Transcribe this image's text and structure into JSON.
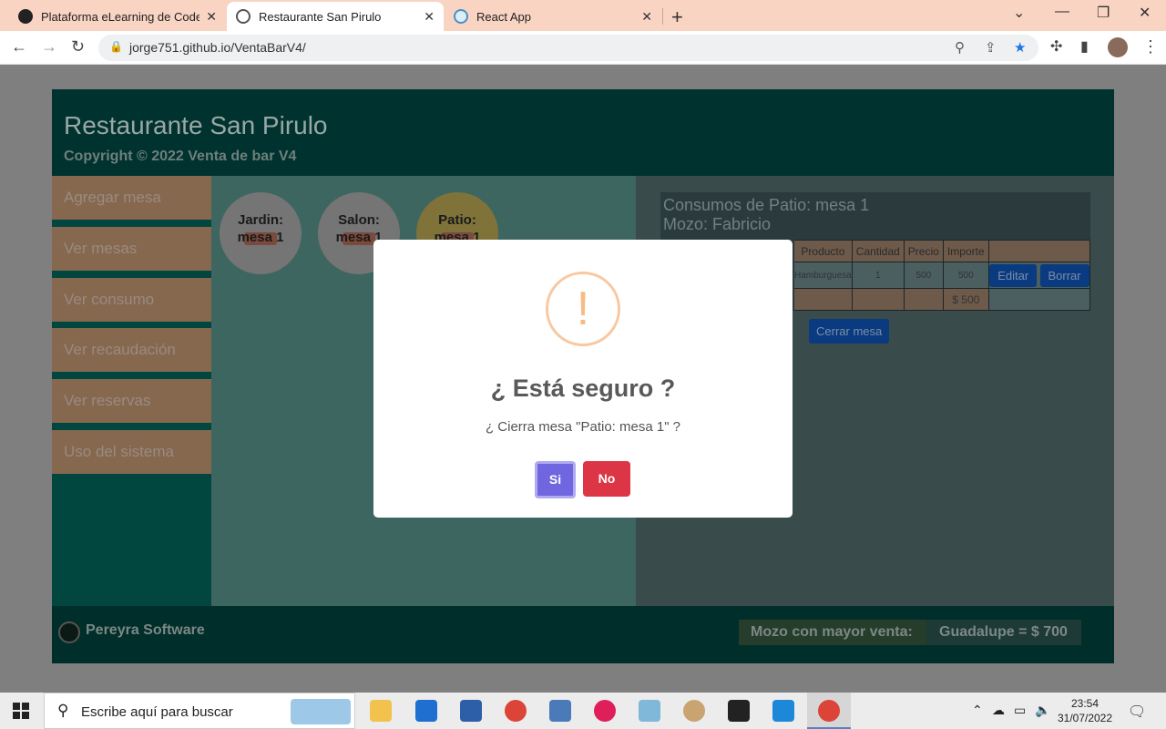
{
  "browser": {
    "tabs": [
      {
        "title": "Plataforma eLearning de Coderhouse",
        "active": false
      },
      {
        "title": "Restaurante San Pirulo",
        "active": true
      },
      {
        "title": "React App",
        "active": false
      }
    ],
    "url": "jorge751.github.io/VentaBarV4/"
  },
  "header": {
    "title": "Restaurante San Pirulo",
    "subtitle": "Copyright © 2022 Venta de bar V4"
  },
  "sidebar": {
    "items": [
      "Agregar mesa",
      "Ver mesas",
      "Ver consumo",
      "Ver recaudación",
      "Ver reservas",
      "Uso del sistema"
    ]
  },
  "mesas": [
    {
      "line1": "Jardin:",
      "line2": "mesa 1"
    },
    {
      "line1": "Salon:",
      "line2": "mesa 1"
    },
    {
      "line1": "Patio:",
      "line2": "mesa 1"
    }
  ],
  "consumo": {
    "title": "Consumos de Patio: mesa 1",
    "mozo": "Mozo: Fabricio",
    "columns": [
      "Producto",
      "Cantidad",
      "Precio",
      "Importe"
    ],
    "row": {
      "producto": "Hamburguesa",
      "cantidad": "1",
      "precio": "500",
      "importe": "500"
    },
    "edit_label": "Editar",
    "delete_label": "Borrar",
    "total": "$ 500",
    "close_label": "Cerrar mesa"
  },
  "footer": {
    "brand": "Pereyra Software",
    "mozo_label": "Mozo con mayor venta:",
    "mozo_value": "Guadalupe = $ 700"
  },
  "modal": {
    "icon": "!",
    "title": "¿ Está seguro ?",
    "text": "¿ Cierra mesa \"Patio: mesa 1\" ?",
    "confirm": "Si",
    "cancel": "No"
  },
  "taskbar": {
    "search_placeholder": "Escribe aquí para buscar",
    "time": "23:54",
    "date": "31/07/2022"
  }
}
